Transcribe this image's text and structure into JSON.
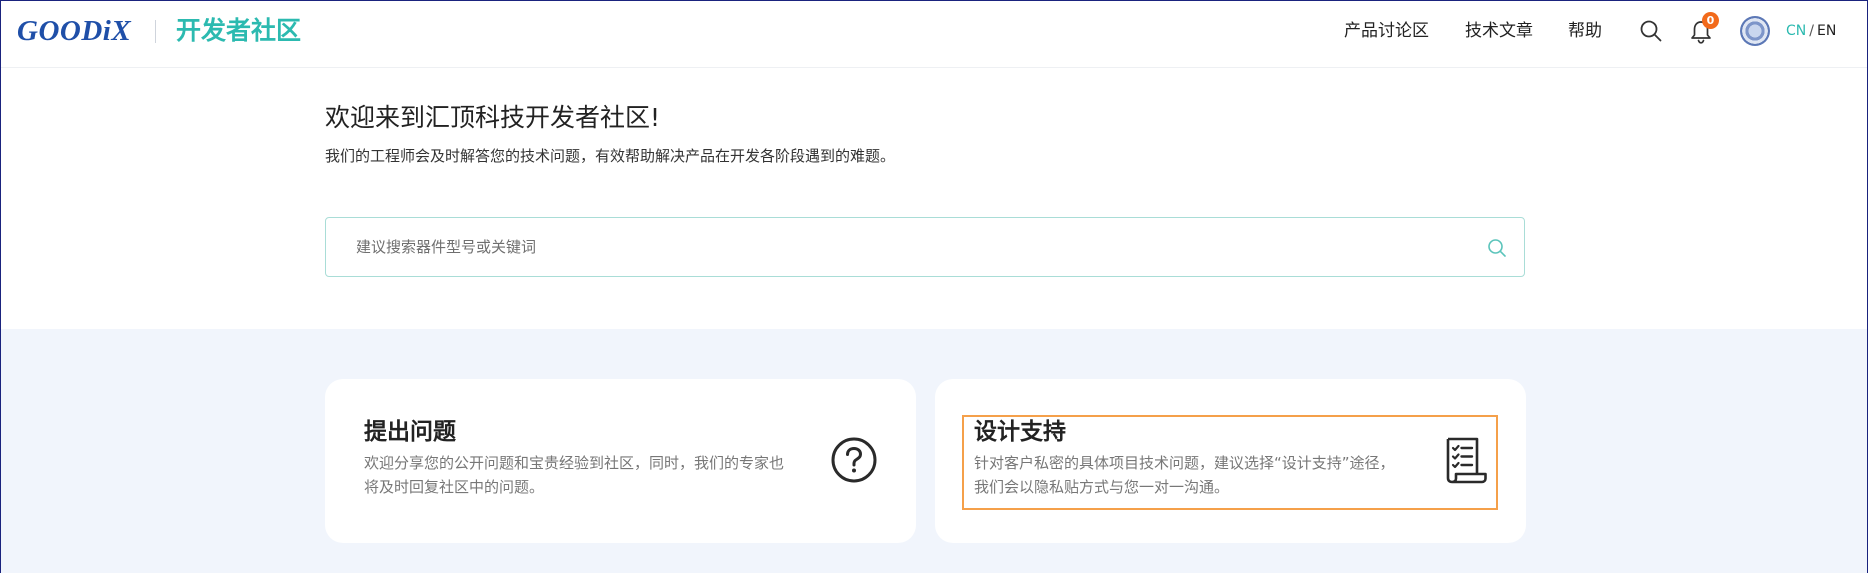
{
  "header": {
    "logo_text": "GOODiX",
    "community_title": "开发者社区",
    "nav": [
      {
        "label": "产品讨论区"
      },
      {
        "label": "技术文章"
      },
      {
        "label": "帮助"
      }
    ],
    "notification_count": "0",
    "lang": {
      "cn": "CN",
      "sep": "/",
      "en": "EN"
    }
  },
  "hero": {
    "title": "欢迎来到汇顶科技开发者社区!",
    "subtitle": "我们的工程师会及时解答您的技术问题，有效帮助解决产品在开发各阶段遇到的难题。",
    "search_placeholder": "建议搜索器件型号或关键词",
    "search_value": ""
  },
  "cards": {
    "ask": {
      "title": "提出问题",
      "desc_line1": "欢迎分享您的公开问题和宝贵经验到社区，同时，我们的专家也",
      "desc_line2": "将及时回复社区中的问题。",
      "icon": "question-circle-icon"
    },
    "design": {
      "title": "设计支持",
      "desc_line1": "针对客户私密的具体项目技术问题，建议选择“设计支持”途径，",
      "desc_line2": "我们会以隐私贴方式与您一对一沟通。",
      "icon": "checklist-scroll-icon"
    }
  },
  "colors": {
    "brand_blue": "#1f4fa8",
    "accent_teal": "#2cbab0",
    "badge_orange": "#f26a1b",
    "lower_bg": "#f1f5fc",
    "focus_orange": "#f5a04a"
  }
}
